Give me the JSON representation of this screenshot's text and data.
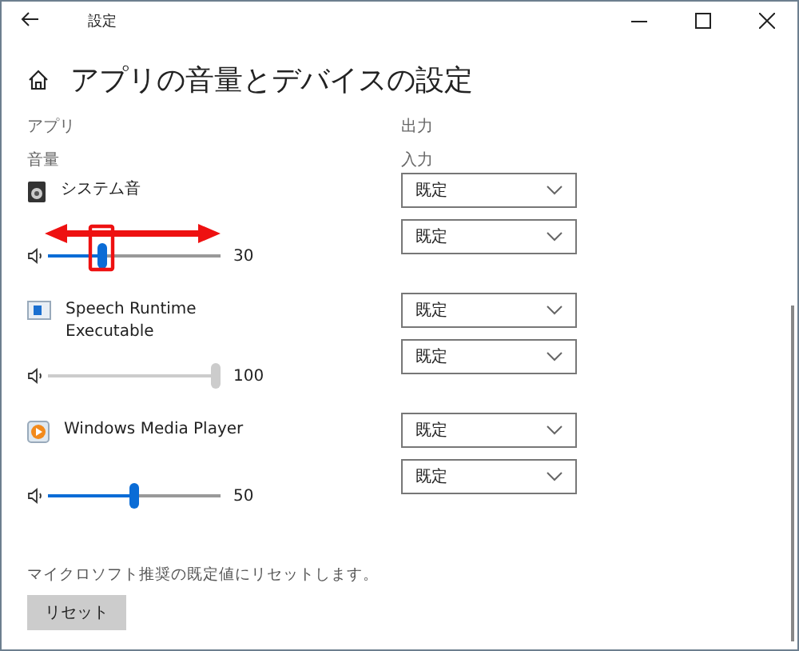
{
  "window": {
    "title": "設定"
  },
  "page": {
    "title": "アプリの音量とデバイスの設定"
  },
  "columns": {
    "app": "アプリ",
    "volume": "音量",
    "output": "出力",
    "input": "入力"
  },
  "apps": [
    {
      "name": "システム音",
      "kind": "system",
      "level": 0.3,
      "reading": "30",
      "highlighted": true,
      "output": "既定",
      "input": "既定"
    },
    {
      "name": "Speech Runtime Executable",
      "kind": "speech",
      "level": 1.0,
      "reading": "100",
      "highlighted": false,
      "output": "既定",
      "input": "既定"
    },
    {
      "name": "Windows Media Player",
      "kind": "media",
      "level": 0.5,
      "reading": "50",
      "highlighted": false,
      "output": "既定",
      "input": "既定"
    }
  ],
  "reset": {
    "description": "マイクロソフト推奨の既定値にリセットします。",
    "button": "リセット"
  }
}
